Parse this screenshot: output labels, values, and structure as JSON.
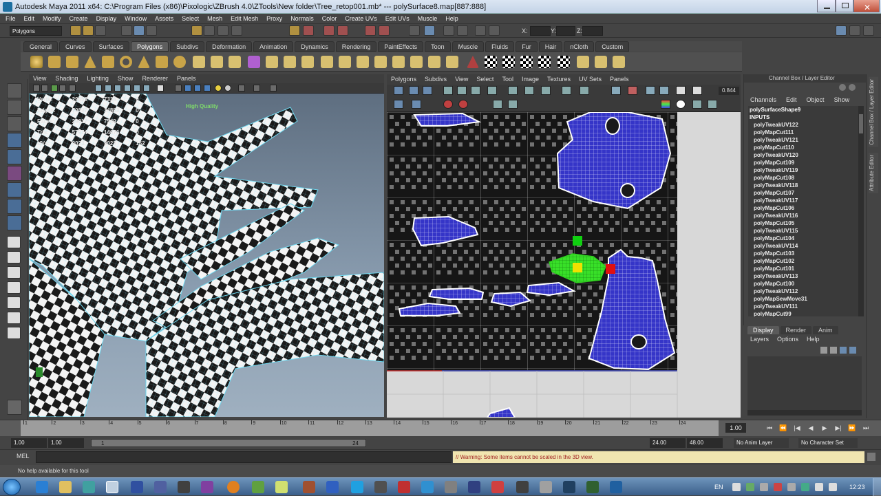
{
  "window": {
    "title": "Autodesk Maya 2011 x64: C:\\Program Files (x86)\\Pixologic\\ZBrush 4.0\\ZTools\\New folder\\Tree_retop001.mb*    ---    polySurface8.map[887:888]"
  },
  "menu": [
    "File",
    "Edit",
    "Modify",
    "Create",
    "Display",
    "Window",
    "Assets",
    "Select",
    "Mesh",
    "Edit Mesh",
    "Proxy",
    "Normals",
    "Color",
    "Create UVs",
    "Edit UVs",
    "Muscle",
    "Help"
  ],
  "status": {
    "mode": "Polygons",
    "x_label": "X:",
    "y_label": "Y:",
    "z_label": "Z:"
  },
  "shelf_tabs": [
    "General",
    "Curves",
    "Surfaces",
    "Polygons",
    "Subdivs",
    "Deformation",
    "Animation",
    "Dynamics",
    "Rendering",
    "PaintEffects",
    "Toon",
    "Muscle",
    "Fluids",
    "Fur",
    "Hair",
    "nCloth",
    "Custom"
  ],
  "shelf_active": "Polygons",
  "viewport": {
    "menu": [
      "View",
      "Shading",
      "Lighting",
      "Show",
      "Renderer",
      "Panels"
    ],
    "hud": [
      {
        "label": "Verts:",
        "a": "29853",
        "b": "7338",
        "c": "0"
      },
      {
        "label": "Edges:",
        "a": "70897",
        "b": "14883",
        "c": "0"
      },
      {
        "label": "Faces:",
        "a": "29017",
        "b": "7549",
        "c": "0"
      },
      {
        "label": "Tris:",
        "a": "57974",
        "b": "14676",
        "c": "0"
      },
      {
        "label": "UVs:",
        "a": "9023",
        "b": "9023",
        "c": "152"
      }
    ],
    "quality": "High Quality"
  },
  "uv_editor": {
    "menu": [
      "Polygons",
      "Subdivs",
      "View",
      "Select",
      "Tool",
      "Image",
      "Textures",
      "UV Sets",
      "Panels"
    ],
    "value": "0.844"
  },
  "channel_box": {
    "title": "Channel Box / Layer Editor",
    "menu": [
      "Channels",
      "Edit",
      "Object",
      "Show"
    ],
    "items": [
      "polySurfaceShape9",
      "INPUTS",
      "polyTweakUV122",
      "polyMapCut111",
      "polyTweakUV121",
      "polyMapCut110",
      "polyTweakUV120",
      "polyMapCut109",
      "polyTweakUV119",
      "polyMapCut108",
      "polyTweakUV118",
      "polyMapCut107",
      "polyTweakUV117",
      "polyMapCut106",
      "polyTweakUV116",
      "polyMapCut105",
      "polyTweakUV115",
      "polyMapCut104",
      "polyTweakUV114",
      "polyMapCut103",
      "polyMapCut102",
      "polyMapCut101",
      "polyTweakUV113",
      "polyMapCut100",
      "polyTweakUV112",
      "polyMapSewMove31",
      "polyTweakUV111",
      "polyMapCut99"
    ]
  },
  "layer_editor": {
    "tabs": [
      "Display",
      "Render",
      "Anim"
    ],
    "active": "Display",
    "menu": [
      "Layers",
      "Options",
      "Help"
    ]
  },
  "side_tabs": [
    "Channel Box / Layer Editor",
    "Attribute Editor"
  ],
  "timeline": {
    "ticks": [
      "1",
      "2",
      "3",
      "4",
      "5",
      "6",
      "7",
      "8",
      "9",
      "10",
      "11",
      "12",
      "13",
      "14",
      "15",
      "16",
      "17",
      "18",
      "19",
      "20",
      "21",
      "22",
      "23",
      "24"
    ],
    "current": "1.00"
  },
  "range": {
    "start": "1.00",
    "start2": "1.00",
    "slider_start": "1",
    "slider_end": "24",
    "end": "24.00",
    "end2": "48.00",
    "anim_layer": "No Anim Layer",
    "character": "No Character Set"
  },
  "cmd": {
    "label": "MEL",
    "warning": "// Warning: Some items cannot be scaled in the 3D view."
  },
  "help": "No help available for this tool",
  "taskbar": {
    "lang": "EN",
    "time": "12:23"
  },
  "colors": {
    "accent": "#1d6fa0",
    "uv_wire": "#3b3bd8",
    "selected": "#33ff22"
  }
}
